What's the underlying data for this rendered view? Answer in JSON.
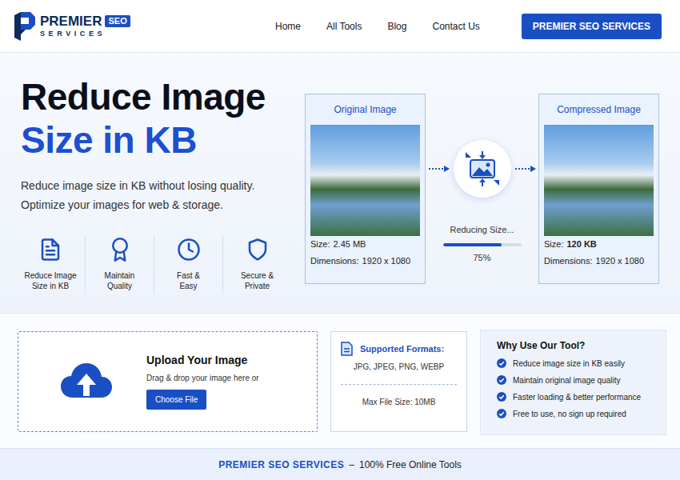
{
  "header": {
    "logo": {
      "name": "PREMIER",
      "badge": "SEO",
      "tagline": "SERVICES"
    },
    "nav": [
      {
        "label": "Home",
        "selected": false
      },
      {
        "label": "All Tools",
        "selected": false
      },
      {
        "label": "Blog",
        "selected": false
      },
      {
        "label": "Contact Us",
        "selected": false
      }
    ],
    "cta": "PREMIER SEO SERVICES"
  },
  "hero": {
    "title": "Reduce Image",
    "highlight": "Size in KB",
    "subtitle": [
      "Reduce image size in KB without losing quality.",
      "Optimize your images for web & storage."
    ],
    "features": [
      {
        "lines": [
          "Reduce Image",
          "Size in KB"
        ]
      },
      {
        "lines": [
          "Maintain",
          "Quality"
        ]
      },
      {
        "lines": [
          "Fast &",
          "Easy"
        ]
      },
      {
        "lines": [
          "Secure &",
          "Private"
        ]
      }
    ]
  },
  "compare": {
    "cards": [
      {
        "title": "Original Image",
        "size_label": "Size:",
        "size": "2.45 MB",
        "size_bold": false,
        "dimensions_label": "Dimensions:",
        "dimensions": "1920 x 1080"
      },
      {
        "title": "Compressed Image",
        "size_label": "Size:",
        "size": "120 KB",
        "size_bold": true,
        "dimensions_label": "Dimensions:",
        "dimensions": "1920 x 1080"
      }
    ],
    "progress": {
      "label": "Reducing Size...",
      "level": 0.75,
      "reading": "75%"
    }
  },
  "upload": {
    "title": "Upload Your Image",
    "hint": "Drag & drop your image here or",
    "button": "Choose File"
  },
  "formats": {
    "title": "Supported Formats:",
    "list": "JPG, JPEG, PNG, WEBP",
    "max": "Max File Size: 10MB"
  },
  "why": {
    "title": "Why Use Our Tool?",
    "items": [
      "Reduce image size in KB easily",
      "Maintain original image quality",
      "Faster loading & better performance",
      "Free to use, no sign up required"
    ]
  },
  "footer": {
    "brand": "PREMIER SEO SERVICES",
    "separator": "–",
    "text": "100% Free Online Tools"
  }
}
